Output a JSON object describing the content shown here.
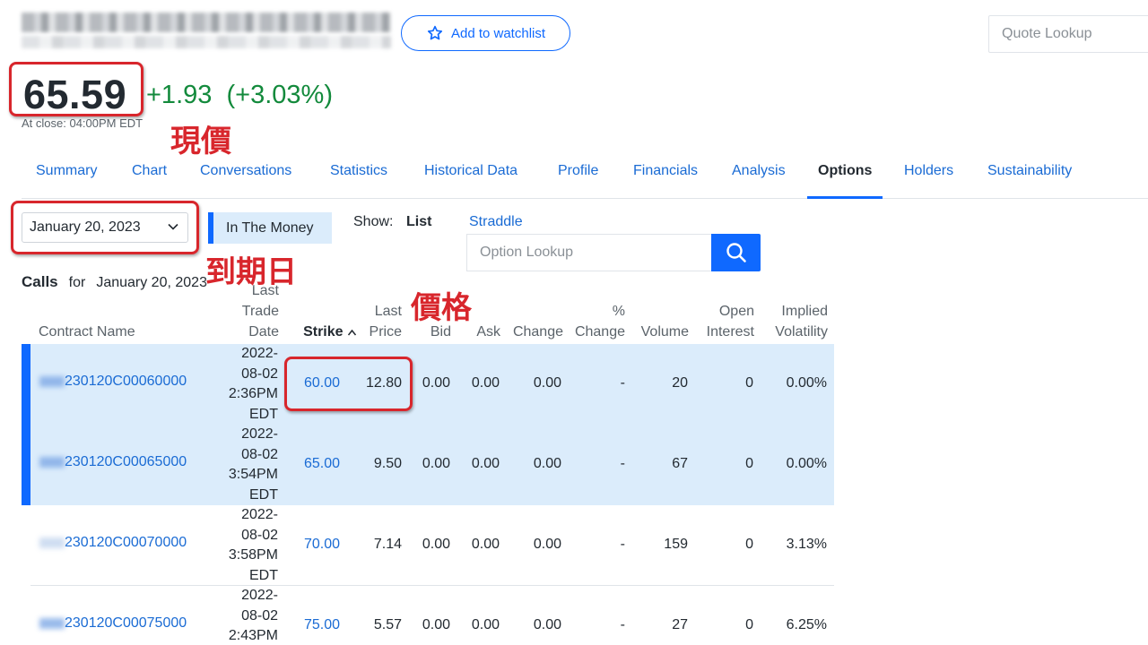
{
  "header": {
    "watchlist_label": "Add to watchlist",
    "quote_lookup_placeholder": "Quote Lookup"
  },
  "quote": {
    "price": "65.59",
    "change": "+1.93  (+3.03%)",
    "close_time": "At close: 04:00PM EDT"
  },
  "annotations": {
    "price": "現價",
    "expiry": "到期日",
    "last_price": "價格"
  },
  "tabs": [
    "Summary",
    "Chart",
    "Conversations",
    "Statistics",
    "Historical Data",
    "Profile",
    "Financials",
    "Analysis",
    "Options",
    "Holders",
    "Sustainability"
  ],
  "active_tab": "Options",
  "controls": {
    "expiry_date": "January 20, 2023",
    "in_the_money": "In The Money",
    "show_label": "Show:",
    "list_label": "List",
    "straddle_label": "Straddle",
    "option_lookup_placeholder": "Option Lookup"
  },
  "calls": {
    "title": "Calls",
    "for_label": "for",
    "date": "January 20, 2023",
    "columns": {
      "contract": "Contract Name",
      "last_trade_date": [
        "Last",
        "Trade",
        "Date"
      ],
      "strike": "Strike",
      "last_price": [
        "Last",
        "Price"
      ],
      "bid": "Bid",
      "ask": "Ask",
      "change": "Change",
      "pct_change": [
        "%",
        "Change"
      ],
      "volume": "Volume",
      "open_interest": [
        "Open",
        "Interest"
      ],
      "implied_volatility": [
        "Implied",
        "Volatility"
      ]
    },
    "rows": [
      {
        "contract": "230120C00060000",
        "date_lines": [
          "2022-",
          "08-02",
          "2:36PM",
          "EDT"
        ],
        "strike": "60.00",
        "last": "12.80",
        "bid": "0.00",
        "ask": "0.00",
        "change": "0.00",
        "pct": "-",
        "volume": "20",
        "oi": "0",
        "iv": "0.00%",
        "in_the_money": true
      },
      {
        "contract": "230120C00065000",
        "date_lines": [
          "2022-",
          "08-02",
          "3:54PM",
          "EDT"
        ],
        "strike": "65.00",
        "last": "9.50",
        "bid": "0.00",
        "ask": "0.00",
        "change": "0.00",
        "pct": "-",
        "volume": "67",
        "oi": "0",
        "iv": "0.00%",
        "in_the_money": true
      },
      {
        "contract": "230120C00070000",
        "date_lines": [
          "2022-",
          "08-02",
          "3:58PM",
          "EDT"
        ],
        "strike": "70.00",
        "last": "7.14",
        "bid": "0.00",
        "ask": "0.00",
        "change": "0.00",
        "pct": "-",
        "volume": "159",
        "oi": "0",
        "iv": "3.13%",
        "in_the_money": false
      },
      {
        "contract": "230120C00075000",
        "date_lines": [
          "2022-",
          "08-02",
          "2:43PM"
        ],
        "strike": "75.00",
        "last": "5.57",
        "bid": "0.00",
        "ask": "0.00",
        "change": "0.00",
        "pct": "-",
        "volume": "27",
        "oi": "0",
        "iv": "6.25%",
        "in_the_money": false
      }
    ]
  },
  "colors": {
    "accent": "#0f69ff",
    "link": "#1a6bd4",
    "positive": "#138a3c",
    "annotation": "#d8262c",
    "itm_background": "#dbecfb"
  }
}
